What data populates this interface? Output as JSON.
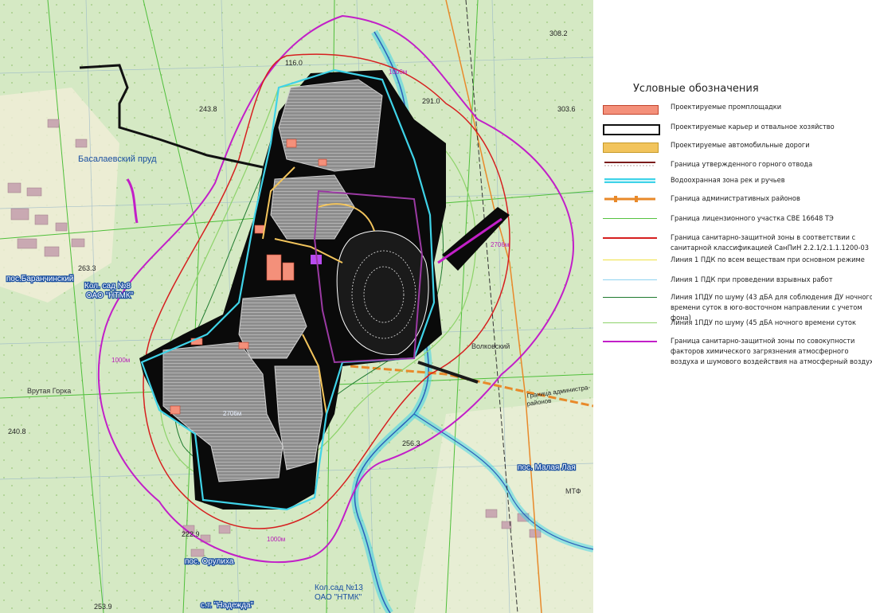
{
  "legend": {
    "title": "Условные обозначения",
    "items": [
      {
        "label": "Проектируемые промплощадки",
        "color": "#f4907a"
      },
      {
        "label": "Проектируемые карьер и отвальное хозяйство",
        "color": "#ffffff"
      },
      {
        "label": "Проектируемые автомобильные дороги",
        "color": "#f2c45c"
      },
      {
        "label": "Граница утвержденного горного отвода",
        "color": "#7a1a1a"
      },
      {
        "label": "Водоохранная зона рек и ручьев",
        "color": "#3fd3e8"
      },
      {
        "label": "Граница административных районов",
        "color": "#e8892a"
      },
      {
        "label": "Граница лицензионного участка СВЕ 16648 ТЭ",
        "color": "#55c240"
      },
      {
        "label": "Граница санитарно-защитной зоны в соответствии с санитарной классификацией СанПиН 2.2.1/2.1.1.1200-03",
        "color": "#d61f1f"
      },
      {
        "label": "Линия 1 ПДК по всем веществам при основном режиме",
        "color": "#f0e040"
      },
      {
        "label": "Линия 1 ПДК при проведении взрывных работ",
        "color": "#8fd3f0"
      },
      {
        "label": "Линия 1ПДУ по шуму (43 дБА для соблюдения ДУ ночного времени суток в юго-восточном направлении с учетом фона)",
        "color": "#1f7a2e"
      },
      {
        "label": "Линия 1ПДУ по шуму (45 дБА ночного времени суток",
        "color": "#8dd36a"
      },
      {
        "label": "Граница санитарно-защитной зоны по совокупности факторов химического загрязнения атмосферного воздуха и шумового воздействия на атмосферный воздух",
        "color": "#c21fc8"
      }
    ]
  },
  "map": {
    "places": {
      "basalaevsky": "Басалаевский пруд",
      "baranchinsky": "пос.Баранчинский",
      "kolsad8_a": "Кол. сад №8",
      "kolsad8_b": "ОАО \"НТМК\"",
      "orulikha": "пос. Орулиха",
      "nadezhda": "с.т. \"Надежда\"",
      "kolsad13_a": "Кол.сад №13",
      "kolsad13_b": "ОАО \"НТМК\"",
      "malaya_laya": "пос. Малая Лая",
      "granitsa_a": "Граница администра-",
      "granitsa_b": "районов",
      "vrutaya": "Врутая Горка",
      "volkovsky": "Волковский",
      "mtf": "МТФ"
    },
    "marks": {
      "m1000": "1000м",
      "m2706": "2706м",
      "e3036": "303.6",
      "e3082": "308.2",
      "e2910": "291.0",
      "e2438": "243.8",
      "e2633": "263.3",
      "e2229": "222.9",
      "e2539": "253.9",
      "e2563": "256.3",
      "e2408": "240.8",
      "e1160": "116.0"
    }
  }
}
